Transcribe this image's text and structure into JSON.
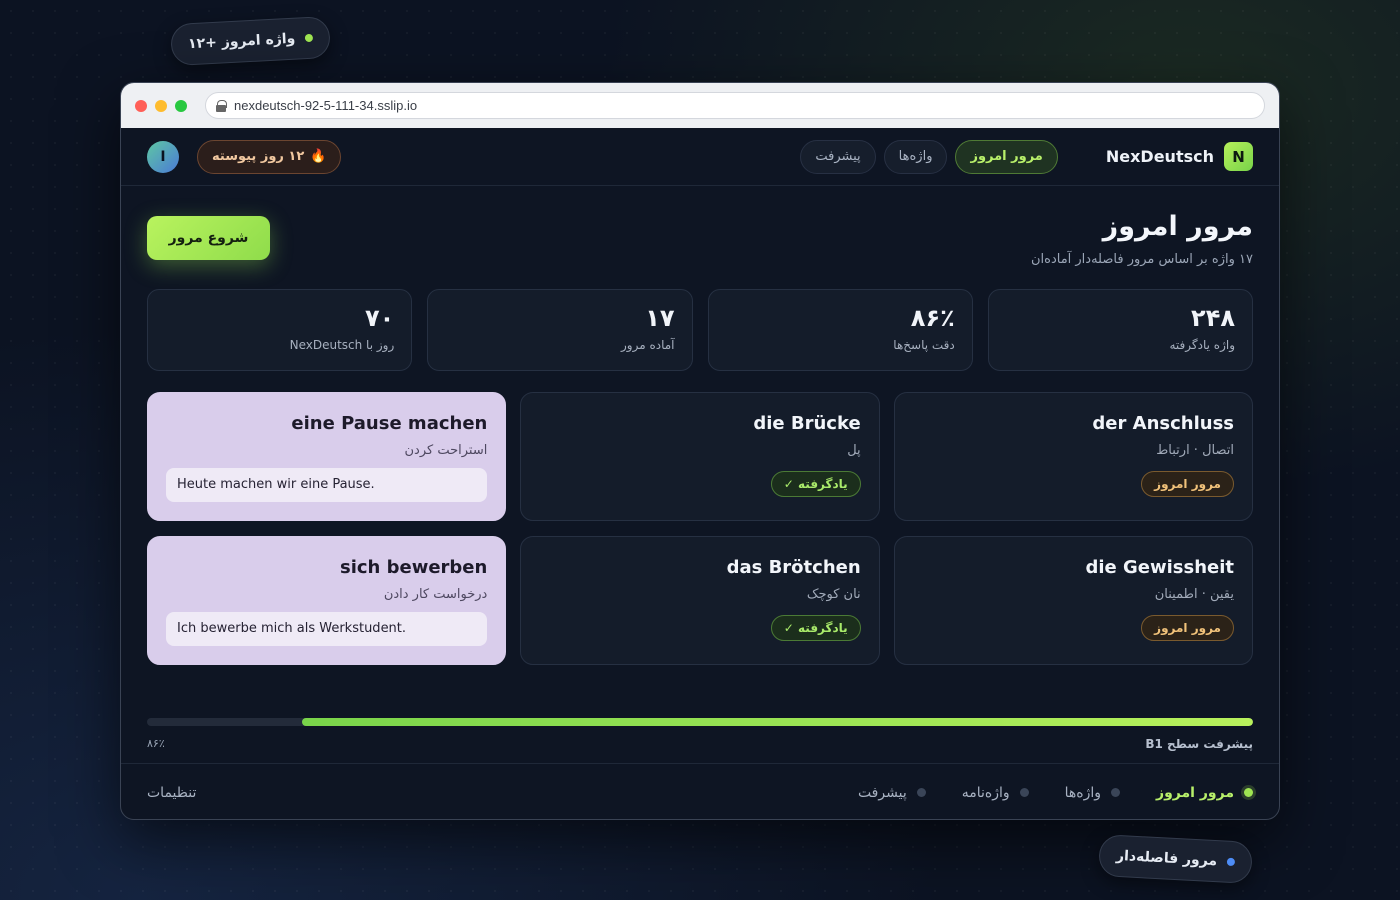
{
  "floating": {
    "top_pill": "واژه امروز +۱۲",
    "bottom_pill": "مرور فاصله‌دار"
  },
  "browser": {
    "url": "nexdeutsch-92-5-111-34.sslip.io"
  },
  "brand": {
    "logo_letter": "N",
    "name": "NexDeutsch"
  },
  "nav": {
    "tabs": [
      {
        "label": "مرور امروز",
        "active": true
      },
      {
        "label": "واژه‌ها",
        "active": false
      },
      {
        "label": "پیشرفت",
        "active": false
      }
    ],
    "streak": "۱۲ روز پیوسته",
    "avatar_letter": "I"
  },
  "header": {
    "title": "مرور امروز",
    "subtitle": "۱۷ واژه بر اساس مرور فاصله‌دار آماده‌ان",
    "start_button": "شروع مرور"
  },
  "stats": [
    {
      "value": "۲۴۸",
      "label": "واژه یادگرفته"
    },
    {
      "value": "۸۶٪",
      "label": "دقت پاسخ‌ها"
    },
    {
      "value": "۱۷",
      "label": "آماده مرور"
    },
    {
      "value": "۷۰",
      "label": "روز با NexDeutsch"
    }
  ],
  "cards": [
    {
      "word": "der Anschluss",
      "translation": "اتصال · ارتباط",
      "badge": "مرور امروز",
      "badge_type": "review"
    },
    {
      "word": "die Brücke",
      "translation": "پل",
      "badge": "یادگرفته ✓",
      "badge_type": "learned"
    },
    {
      "word": "eine Pause machen",
      "translation": "استراحت کردن",
      "example": "Heute machen wir eine Pause."
    },
    {
      "word": "die Gewissheit",
      "translation": "یقین · اطمینان",
      "badge": "مرور امروز",
      "badge_type": "review"
    },
    {
      "word": "das Brötchen",
      "translation": "نان کوچک",
      "badge": "یادگرفته ✓",
      "badge_type": "learned"
    },
    {
      "word": "sich bewerben",
      "translation": "درخواست کار دادن",
      "example": "Ich bewerbe mich als Werkstudent."
    }
  ],
  "progress": {
    "label": "پیشرفت سطح B1",
    "percent_text": "۸۶٪",
    "value": 0.86
  },
  "bottom_nav": {
    "items": [
      {
        "label": "مرور امروز",
        "active": true
      },
      {
        "label": "واژه‌ها",
        "active": false
      },
      {
        "label": "واژه‌نامه",
        "active": false
      },
      {
        "label": "پیشرفت",
        "active": false
      }
    ],
    "settings": "تنظیمات"
  },
  "colors": {
    "accent": "#b8f06a",
    "review": "#f1c27a",
    "flip_card": "#d9cdeb",
    "background": "#0c1322"
  }
}
